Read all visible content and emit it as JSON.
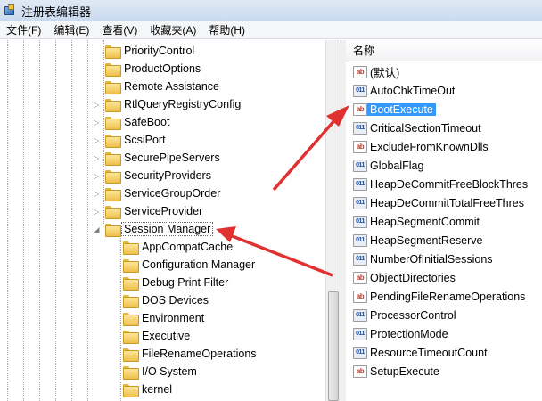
{
  "window": {
    "title": "注册表编辑器"
  },
  "menu": [
    "文件(F)",
    "编辑(E)",
    "查看(V)",
    "收藏夹(A)",
    "帮助(H)"
  ],
  "tree": {
    "items": [
      {
        "label": "PriorityControl",
        "expander": ""
      },
      {
        "label": "ProductOptions",
        "expander": ""
      },
      {
        "label": "Remote Assistance",
        "expander": ""
      },
      {
        "label": "RtlQueryRegistryConfig",
        "expander": "▷"
      },
      {
        "label": "SafeBoot",
        "expander": "▷"
      },
      {
        "label": "ScsiPort",
        "expander": "▷"
      },
      {
        "label": "SecurePipeServers",
        "expander": "▷"
      },
      {
        "label": "SecurityProviders",
        "expander": "▷"
      },
      {
        "label": "ServiceGroupOrder",
        "expander": "▷"
      },
      {
        "label": "ServiceProvider",
        "expander": "▷"
      },
      {
        "label": "Session Manager",
        "expander": "◢"
      }
    ],
    "children": [
      {
        "label": "AppCompatCache"
      },
      {
        "label": "Configuration Manager"
      },
      {
        "label": "Debug Print Filter"
      },
      {
        "label": "DOS Devices"
      },
      {
        "label": "Environment"
      },
      {
        "label": "Executive"
      },
      {
        "label": "FileRenameOperations"
      },
      {
        "label": "I/O System"
      },
      {
        "label": "kernel"
      }
    ]
  },
  "values": {
    "header": "名称",
    "rows": [
      {
        "name": "(默认)",
        "type": "sz"
      },
      {
        "name": "AutoChkTimeOut",
        "type": "bin"
      },
      {
        "name": "BootExecute",
        "type": "sz"
      },
      {
        "name": "CriticalSectionTimeout",
        "type": "bin"
      },
      {
        "name": "ExcludeFromKnownDlls",
        "type": "sz"
      },
      {
        "name": "GlobalFlag",
        "type": "bin"
      },
      {
        "name": "HeapDeCommitFreeBlockThres",
        "type": "bin"
      },
      {
        "name": "HeapDeCommitTotalFreeThres",
        "type": "bin"
      },
      {
        "name": "HeapSegmentCommit",
        "type": "bin"
      },
      {
        "name": "HeapSegmentReserve",
        "type": "bin"
      },
      {
        "name": "NumberOfInitialSessions",
        "type": "bin"
      },
      {
        "name": "ObjectDirectories",
        "type": "sz"
      },
      {
        "name": "PendingFileRenameOperations",
        "type": "sz"
      },
      {
        "name": "ProcessorControl",
        "type": "bin"
      },
      {
        "name": "ProtectionMode",
        "type": "bin"
      },
      {
        "name": "ResourceTimeoutCount",
        "type": "bin"
      },
      {
        "name": "SetupExecute",
        "type": "sz"
      }
    ],
    "selected": "BootExecute"
  },
  "icons": {
    "sz": {
      "glyph": "ab",
      "name": "string-value-icon"
    },
    "bin": {
      "glyph": "011",
      "name": "binary-value-icon"
    }
  },
  "colors": {
    "arrow": "#e0302f",
    "selection": "#3399ff"
  }
}
